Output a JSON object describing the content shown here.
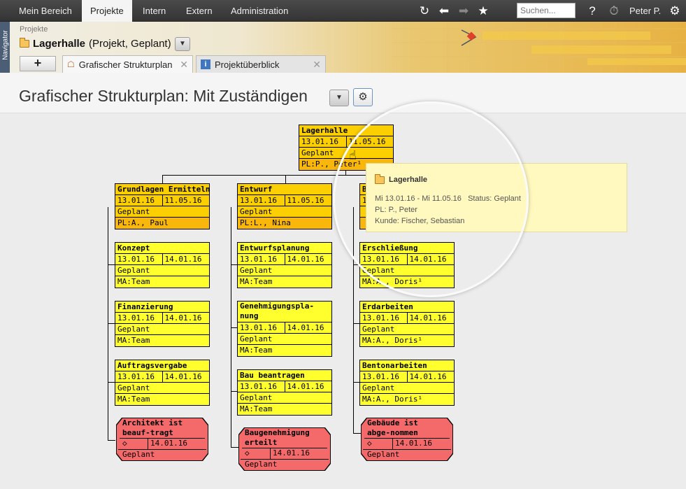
{
  "topnav": {
    "tabs": [
      "Mein Bereich",
      "Projekte",
      "Intern",
      "Extern",
      "Administration"
    ],
    "active_tab": "Projekte",
    "search_placeholder": "Suchen...",
    "help_label": "?",
    "user_name": "Peter P.",
    "icons": [
      "refresh-icon",
      "back-icon",
      "forward-icon",
      "star-icon",
      "timer-icon",
      "gear-icon"
    ]
  },
  "sidebar": {
    "navigator_label": "Navigator"
  },
  "header": {
    "breadcrumb": "Projekte",
    "project_name": "Lagerhalle",
    "project_meta": "(Projekt, Geplant)",
    "add_tab_label": "+",
    "tabs": [
      {
        "label": "Grafischer Strukturplan",
        "icon": "tree-icon",
        "active": true
      },
      {
        "label": "Projektüberblick",
        "icon": "info-icon",
        "active": false
      }
    ]
  },
  "page": {
    "title": "Grafischer Strukturplan: Mit Zuständigen"
  },
  "wbs": {
    "root": {
      "title": "Lagerhalle",
      "start": "13.01.16",
      "end": "11.05.16",
      "status": "Geplant",
      "person": "PL:P., Peter¹"
    },
    "columns": [
      {
        "summary": {
          "title": "Grundlagen Ermitteln",
          "start": "13.01.16",
          "end": "11.05.16",
          "status": "Geplant",
          "person": "PL:A., Paul"
        },
        "tasks": [
          {
            "title": "Konzept",
            "start": "13.01.16",
            "end": "14.01.16",
            "status": "Geplant",
            "person": "MA:Team"
          },
          {
            "title": "Finanzierung",
            "start": "13.01.16",
            "end": "14.01.16",
            "status": "Geplant",
            "person": "MA:Team"
          },
          {
            "title": "Auftragsvergabe",
            "start": "13.01.16",
            "end": "14.01.16",
            "status": "Geplant",
            "person": "MA:Team"
          }
        ],
        "milestone": {
          "title": "Architekt ist beauf-tragt",
          "symbol": "◇",
          "date": "14.01.16",
          "status": "Geplant"
        }
      },
      {
        "summary": {
          "title": "Entwurf",
          "start": "13.01.16",
          "end": "11.05.16",
          "status": "Geplant",
          "person": "PL:L., Nina"
        },
        "tasks": [
          {
            "title": "Entwurfsplanung",
            "start": "13.01.16",
            "end": "14.01.16",
            "status": "Geplant",
            "person": "MA:Team"
          },
          {
            "title": "Genehmigungspla-nung",
            "start": "13.01.16",
            "end": "14.01.16",
            "status": "Geplant",
            "person": "MA:Team"
          },
          {
            "title": "Bau beantragen",
            "start": "13.01.16",
            "end": "14.01.16",
            "status": "Geplant",
            "person": "MA:Team"
          }
        ],
        "milestone": {
          "title": "Baugenehmigung erteilt",
          "symbol": "◇",
          "date": "14.01.16",
          "status": "Geplant"
        }
      },
      {
        "summary": {
          "title": "B",
          "start": "1",
          "end": "",
          "status": "",
          "person": ""
        },
        "tasks": [
          {
            "title": "Erschließung",
            "start": "13.01.16",
            "end": "14.01.16",
            "status": "Geplant",
            "person": "MA:A., Doris¹"
          },
          {
            "title": "Erdarbeiten",
            "start": "13.01.16",
            "end": "14.01.16",
            "status": "Geplant",
            "person": "MA:A., Doris¹"
          },
          {
            "title": "Bentonarbeiten",
            "start": "13.01.16",
            "end": "14.01.16",
            "status": "Geplant",
            "person": "MA:A., Doris¹"
          }
        ],
        "milestone": {
          "title": "Gebäude ist abge-nommen",
          "symbol": "◇",
          "date": "14.01.16",
          "status": "Geplant"
        }
      }
    ]
  },
  "tooltip": {
    "title": "Lagerhalle",
    "dates": "Mi 13.01.16 - Mi 11.05.16",
    "status": "Status: Geplant",
    "pl": "PL: P., Peter",
    "customer": "Kunde: Fischer, Sebastian"
  },
  "colors": {
    "summary_node": "#fcd000",
    "task_node": "#ffff2e",
    "milestone": "#f46a6a",
    "tooltip_bg": "#fff9bf"
  }
}
